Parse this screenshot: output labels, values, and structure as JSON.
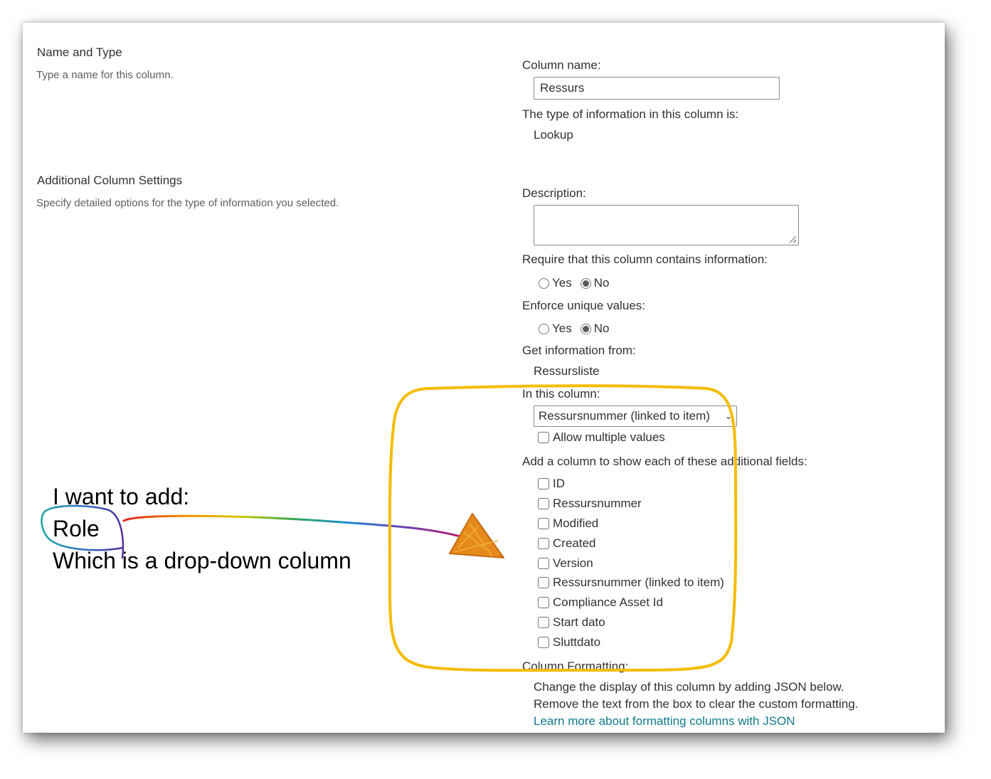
{
  "sections": {
    "name_type": {
      "title": "Name and Type",
      "description": "Type a name for this column."
    },
    "additional": {
      "title": "Additional Column Settings",
      "description": "Specify detailed options for the type of information you selected."
    }
  },
  "column_name": {
    "label": "Column name:",
    "value": "Ressurs"
  },
  "type_info": {
    "label": "The type of information in this column is:",
    "value": "Lookup"
  },
  "description": {
    "label": "Description:",
    "value": ""
  },
  "require": {
    "label": "Require that this column contains information:",
    "yes": "Yes",
    "no": "No",
    "selected": "No"
  },
  "unique": {
    "label": "Enforce unique values:",
    "yes": "Yes",
    "no": "No",
    "selected": "No"
  },
  "get_info": {
    "label": "Get information from:",
    "value": "Ressursliste"
  },
  "in_column": {
    "label": "In this column:",
    "selected": "Ressursnummer (linked to item)",
    "allow_multiple": "Allow multiple values"
  },
  "additional_fields": {
    "label": "Add a column to show each of these additional fields:",
    "items": [
      "ID",
      "Ressursnummer",
      "Modified",
      "Created",
      "Version",
      "Ressursnummer (linked to item)",
      "Compliance Asset Id",
      "Start dato",
      "Sluttdato"
    ]
  },
  "formatting": {
    "label": "Column Formatting:",
    "line1": "Change the display of this column by adding JSON below.",
    "line2": "Remove the text from the box to clear the custom formatting.",
    "link": "Learn more about formatting columns with JSON"
  },
  "annotation": {
    "line1": "I want to add:",
    "line2": "Role",
    "line3": "Which is a drop-down column",
    "highlight_color": "#f5bc00"
  }
}
